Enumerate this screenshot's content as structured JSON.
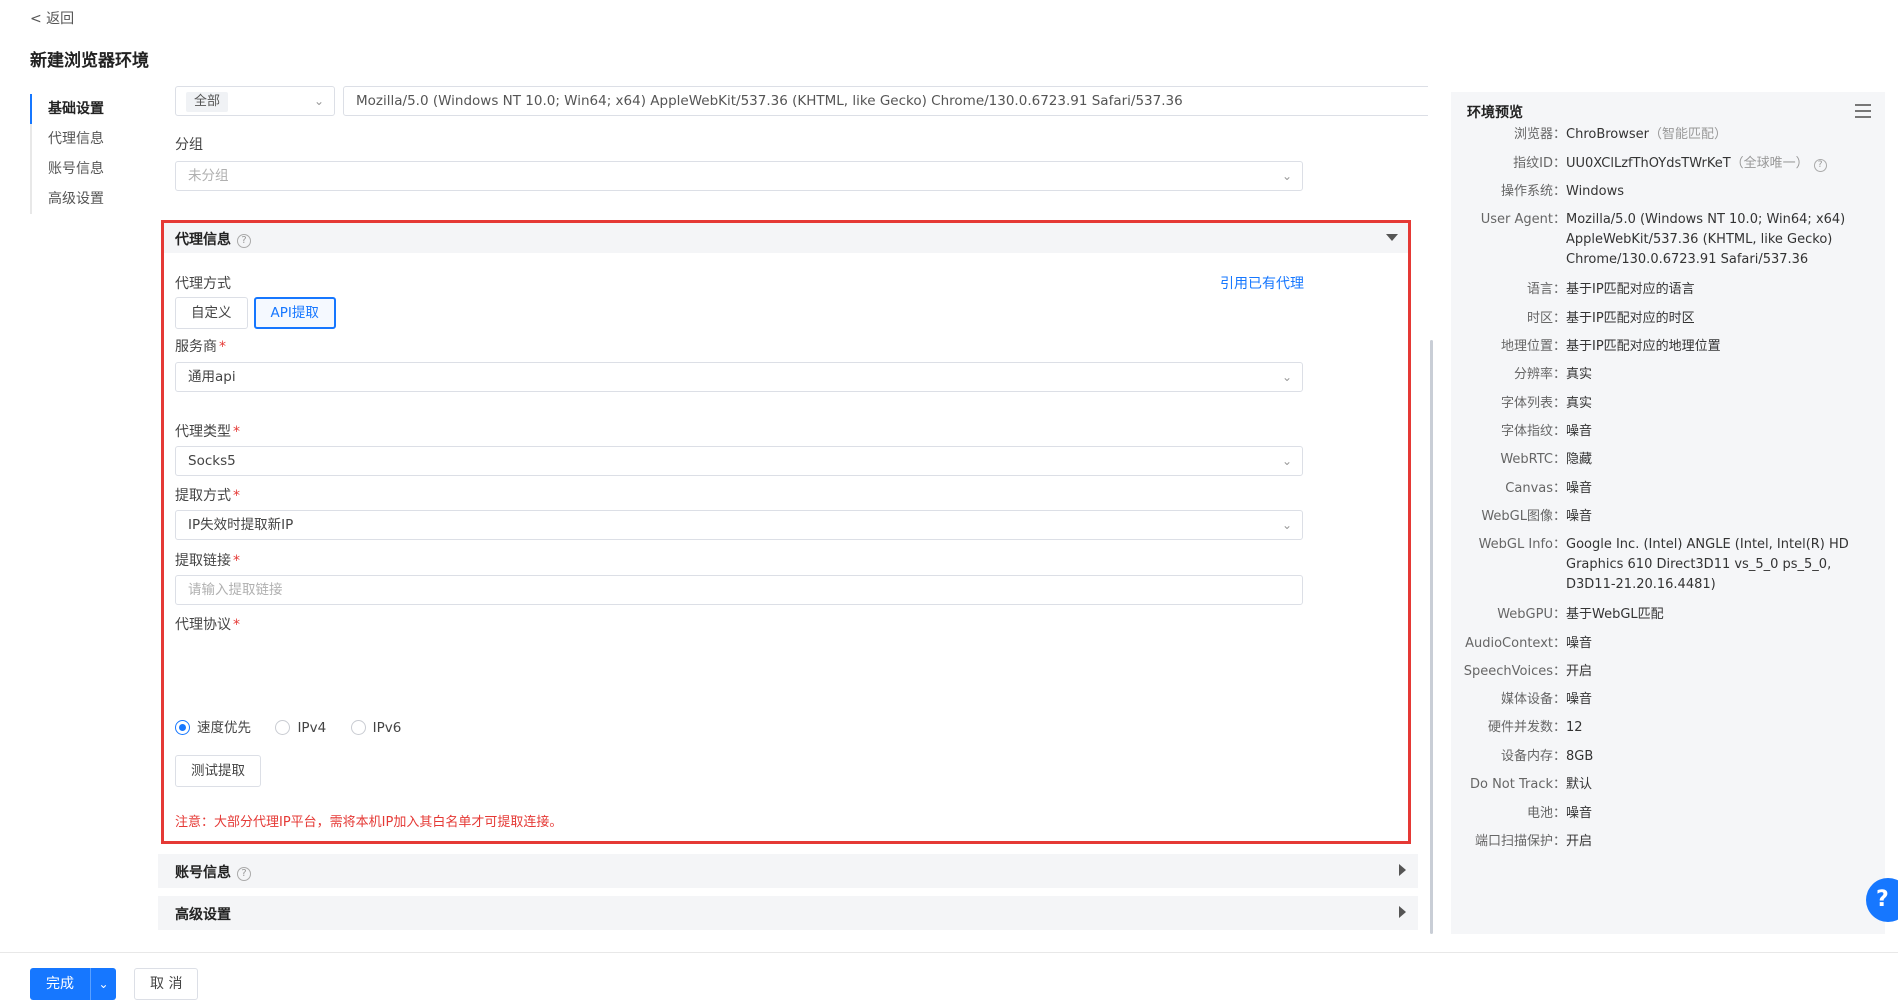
{
  "header": {
    "back_label": "< 返回",
    "title": "新建浏览器环境"
  },
  "sidebar": {
    "items": [
      {
        "label": "基础设置",
        "active": true
      },
      {
        "label": "代理信息",
        "active": false
      },
      {
        "label": "账号信息",
        "active": false
      },
      {
        "label": "高级设置",
        "active": false
      }
    ]
  },
  "ua_row": {
    "platform_select": "全部",
    "user_agent": "Mozilla/5.0 (Windows NT 10.0; Win64; x64) AppleWebKit/537.36 (KHTML, like Gecko) Chrome/130.0.6723.91 Safari/537.36",
    "shuffle_icon": "⤮"
  },
  "group": {
    "label": "分组",
    "placeholder": "未分组"
  },
  "proxy": {
    "title": "代理信息",
    "help_icon": "?",
    "method_label": "代理方式",
    "use_existing": "引用已有代理",
    "method_options": [
      "自定义",
      "API提取"
    ],
    "method_selected": "API提取",
    "provider_label": "服务商",
    "provider_value": "通用api",
    "type_label": "代理类型",
    "type_value": "Socks5",
    "extract_mode_label": "提取方式",
    "extract_mode_value": "IP失效时提取新IP",
    "extract_link_label": "提取链接",
    "extract_link_placeholder": "请输入提取链接",
    "protocol_label": "代理协议",
    "protocol_options": [
      "速度优先",
      "IPv4",
      "IPv6"
    ],
    "protocol_selected": "速度优先",
    "test_button": "测试提取",
    "note": "注意：大部分代理IP平台，需将本机IP加入其白名单才可提取连接。"
  },
  "account_section": {
    "title": "账号信息",
    "help_icon": "?"
  },
  "advanced_section": {
    "title": "高级设置"
  },
  "preview": {
    "title": "环境预览",
    "rows": [
      {
        "k": "浏览器：",
        "v": "ChroBrowser",
        "hint": "（智能匹配）"
      },
      {
        "k": "指纹ID：",
        "v": "UU0XClLzfThOYdsTWrKeT",
        "hint": "（全球唯一）"
      },
      {
        "k": "操作系统：",
        "v": "Windows"
      },
      {
        "k": "User Agent：",
        "v": "Mozilla/5.0 (Windows NT 10.0; Win64; x64) AppleWebKit/537.36 (KHTML, like Gecko) Chrome/130.0.6723.91 Safari/537.36"
      },
      {
        "k": "语言：",
        "v": "基于IP匹配对应的语言"
      },
      {
        "k": "时区：",
        "v": "基于IP匹配对应的时区"
      },
      {
        "k": "地理位置：",
        "v": "基于IP匹配对应的地理位置"
      },
      {
        "k": "分辨率：",
        "v": "真实"
      },
      {
        "k": "字体列表：",
        "v": "真实"
      },
      {
        "k": "字体指纹：",
        "v": "噪音"
      },
      {
        "k": "WebRTC：",
        "v": "隐藏"
      },
      {
        "k": "Canvas：",
        "v": "噪音"
      },
      {
        "k": "WebGL图像：",
        "v": "噪音"
      },
      {
        "k": "WebGL Info：",
        "v": "Google Inc. (Intel) ANGLE (Intel, Intel(R) HD Graphics 610 Direct3D11 vs_5_0 ps_5_0, D3D11-21.20.16.4481)"
      },
      {
        "k": "WebGPU：",
        "v": "基于WebGL匹配"
      },
      {
        "k": "AudioContext：",
        "v": "噪音"
      },
      {
        "k": "SpeechVoices：",
        "v": "开启"
      },
      {
        "k": "媒体设备：",
        "v": "噪音"
      },
      {
        "k": "硬件并发数：",
        "v": "12"
      },
      {
        "k": "设备内存：",
        "v": "8GB"
      },
      {
        "k": "Do Not Track：",
        "v": "默认"
      },
      {
        "k": "电池：",
        "v": "噪音"
      },
      {
        "k": "端口扫描保护：",
        "v": "开启"
      }
    ]
  },
  "help_fab": "?",
  "footer": {
    "done": "完成",
    "cancel": "取 消"
  },
  "colors": {
    "accent": "#1677ff",
    "highlight_border": "#e53935",
    "note_text": "#e53935"
  }
}
